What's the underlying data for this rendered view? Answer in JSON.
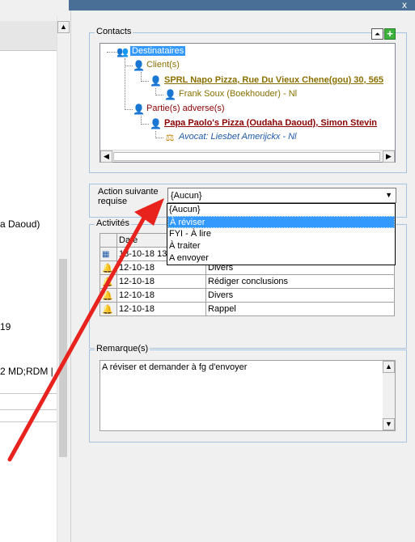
{
  "window": {
    "close_glyph": "x"
  },
  "left_panel": {
    "texts": [
      "a Daoud)",
      "19",
      "2 MD;RDM |"
    ]
  },
  "contacts": {
    "legend": "Contacts",
    "collapse_glyph": "⏶",
    "add_glyph": "+",
    "tree": {
      "root": "Destinataires",
      "clients_label": "Client(s)",
      "client_name": "SPRL Napo Pizza, Rue Du Vieux Chene(gou) 30, 565",
      "client_contact": "Frank Soux (Boekhouder) - Nl",
      "adverse_label": "Partie(s) adverse(s)",
      "adverse_name": "Papa Paolo's Pizza (Oudaha Daoud), Simon Stevin",
      "lawyer": "Avocat: Liesbet Amerijckx - Nl"
    },
    "scroll_left": "◀",
    "scroll_right": "▶"
  },
  "action": {
    "label_line1": "Action suivante",
    "label_line2": "requise",
    "selected": "{Aucun}",
    "arrow": "▼",
    "options": [
      "{Aucun}",
      "À réviser",
      "FYI - À lire",
      "À traiter",
      "A envoyer"
    ],
    "highlighted_index": 1
  },
  "activities": {
    "legend": "Activités",
    "column_date": "Date",
    "rows": [
      {
        "date": "18-10-18 13:",
        "type": ""
      },
      {
        "date": "12-10-18",
        "type": "Divers"
      },
      {
        "date": "12-10-18",
        "type": "Rédiger conclusions"
      },
      {
        "date": "12-10-18",
        "type": "Divers"
      },
      {
        "date": "12-10-18",
        "type": "Rappel"
      }
    ]
  },
  "remark": {
    "legend": "Remarque(s)",
    "text": "A réviser et demander à fg d'envoyer",
    "scroll_up": "▲",
    "scroll_down": "▼"
  },
  "colors": {
    "selection": "#3399ff",
    "client_olive": "#8a7000",
    "adverse_red": "#8b0000",
    "lawyer_blue": "#1e5aa8",
    "annotation_arrow": "#e8221c"
  }
}
